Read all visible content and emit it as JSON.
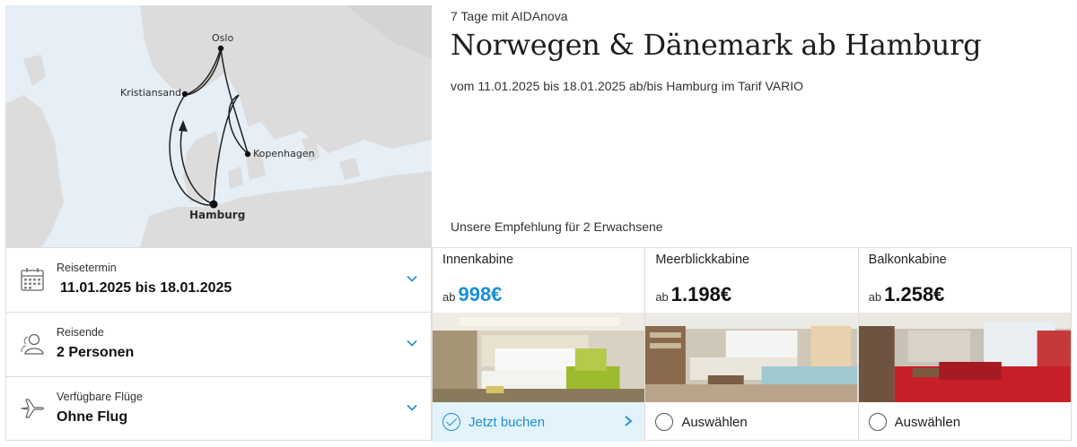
{
  "header": {
    "subtitle": "7 Tage mit AIDAnova",
    "title": "Norwegen & Dänemark ab Hamburg",
    "description": "vom 11.01.2025 bis 18.01.2025 ab/bis Hamburg im Tarif VARIO",
    "recommendation": "Unsere Empfehlung für 2 Erwachsene"
  },
  "map": {
    "ports": [
      "Oslo",
      "Kristiansand",
      "Kopenhagen",
      "Hamburg"
    ]
  },
  "selectors": [
    {
      "label": "Reisetermin",
      "value": "11.01.2025 bis 18.01.2025",
      "icon": "calendar-icon"
    },
    {
      "label": "Reisende",
      "value": "2 Personen",
      "icon": "travelers-icon"
    },
    {
      "label": "Verfügbare Flüge",
      "value": "Ohne Flug",
      "icon": "airplane-icon"
    }
  ],
  "cabins": [
    {
      "name": "Innenkabine",
      "prefix": "ab",
      "price": "998€",
      "action": "Jetzt buchen",
      "selected": true
    },
    {
      "name": "Meerblickkabine",
      "prefix": "ab",
      "price": "1.198€",
      "action": "Auswählen",
      "selected": false
    },
    {
      "name": "Balkonkabine",
      "prefix": "ab",
      "price": "1.258€",
      "action": "Auswählen",
      "selected": false
    }
  ],
  "colors": {
    "accent": "#1a8fd6",
    "selected_bg": "#e3f3fb",
    "map_sea": "#e6eef6",
    "map_land": "#dcdcdc"
  }
}
